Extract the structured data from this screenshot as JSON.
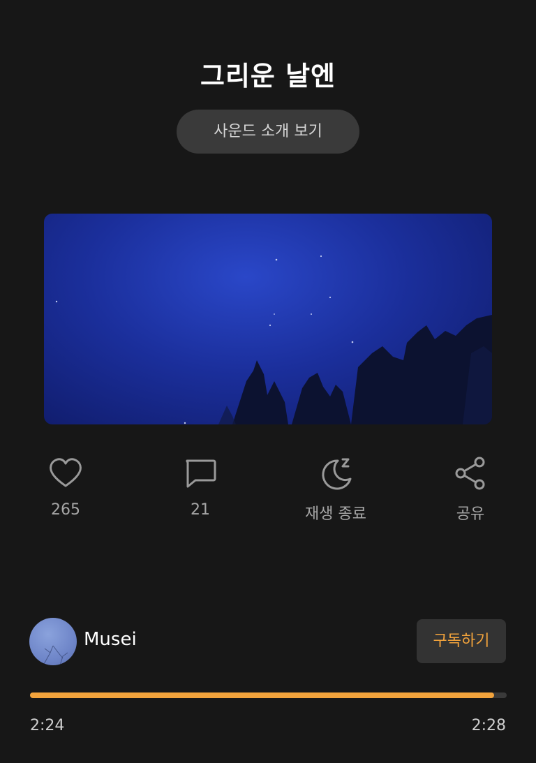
{
  "header": {
    "title": "그리운 날엔",
    "intro_button": "사운드 소개 보기"
  },
  "actions": {
    "like": {
      "icon": "heart-icon",
      "label": "265"
    },
    "comment": {
      "icon": "comment-icon",
      "label": "21"
    },
    "sleep": {
      "icon": "sleep-moon-icon",
      "label": "재생 종료"
    },
    "share": {
      "icon": "share-icon",
      "label": "공유"
    }
  },
  "artist": {
    "name": "Musei",
    "subscribe_label": "구독하기"
  },
  "player": {
    "current_time": "2:24",
    "total_time": "2:28",
    "progress": 0.973
  },
  "colors": {
    "background": "#171717",
    "accent": "#f2a33c",
    "button_bg": "#3a3a3a",
    "muted_text": "#a6a6a6"
  }
}
